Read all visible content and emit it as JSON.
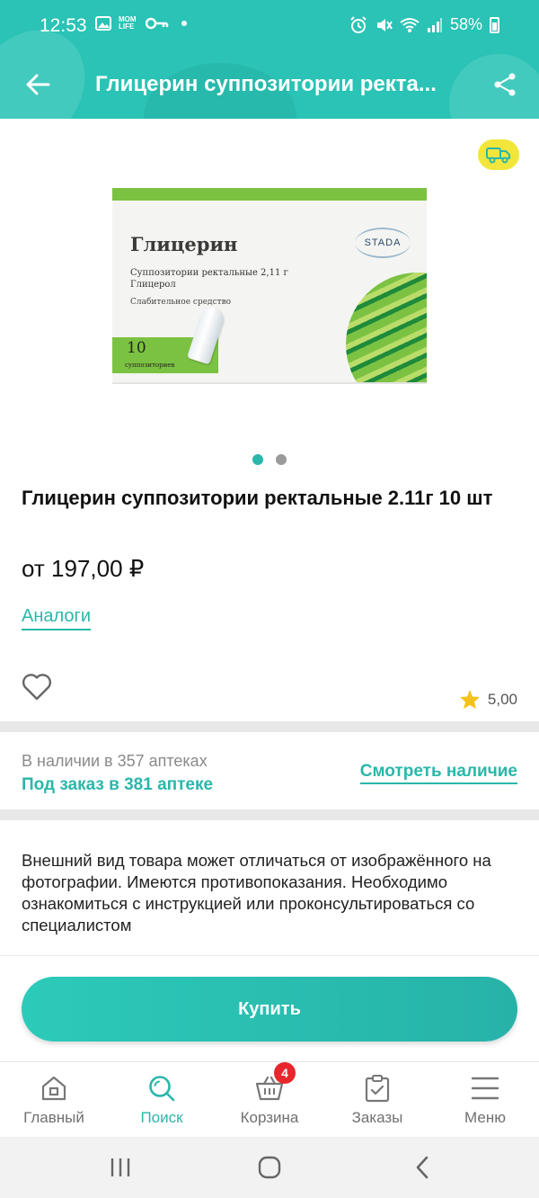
{
  "status_bar": {
    "time": "12:53",
    "battery": "58%",
    "mom_life": "MOM LIFE"
  },
  "header": {
    "title": "Глицерин суппозитории ректа...",
    "icons": [
      "arrow-left-icon",
      "share-icon"
    ],
    "color": "#2ac3b5"
  },
  "product_image": {
    "brand": "Глицерин",
    "form_line1": "Суппозитории ректальные 2,11 г",
    "form_line2": "Глицерол",
    "purpose": "Слабительное средство",
    "manufacturer": "STADA",
    "count": "10",
    "count_word": "суппозиториев",
    "carousel_pages": 2,
    "carousel_active": 1
  },
  "product": {
    "name": "Глицерин суппозитории ректальные 2.11г 10 шт",
    "price": "от 197,00 ₽",
    "analogs_link": "Аналоги",
    "rating": "5,00"
  },
  "availability": {
    "in_stock": "В наличии в 357 аптеках",
    "on_order": "Под заказ в 381 аптеке",
    "see_link": "Смотреть наличие"
  },
  "notice": "Внешний вид товара может отличаться от изображённого на фотографии. Имеются противопоказания. Необходимо ознакомиться с инструкцией или проконсультироваться со специалистом",
  "buy_button": "Купить",
  "bottom_nav": {
    "items": [
      {
        "label": "Главный",
        "icon": "home-icon"
      },
      {
        "label": "Поиск",
        "icon": "search-icon"
      },
      {
        "label": "Корзина",
        "icon": "basket-icon"
      },
      {
        "label": "Заказы",
        "icon": "orders-icon"
      },
      {
        "label": "Меню",
        "icon": "menu-icon"
      }
    ],
    "active": "Поиск",
    "cart_badge": "4"
  },
  "colors": {
    "accent": "#2ab7aa",
    "badge": "#e8262b",
    "delivery_highlight": "#f2e63b",
    "star": "#f4c21b"
  }
}
